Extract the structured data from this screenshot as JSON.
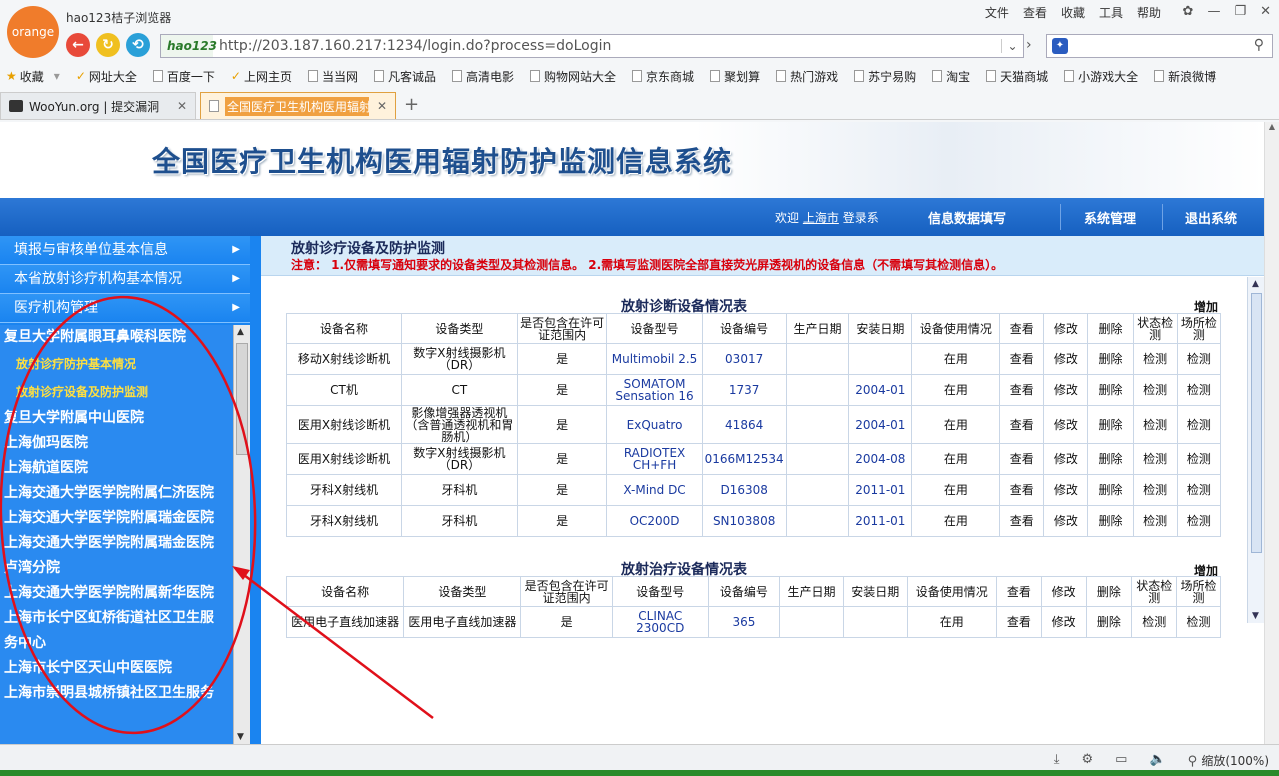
{
  "browser": {
    "logo_text": "orange",
    "app_title": "hao123桔子浏览器",
    "menu": [
      "文件",
      "查看",
      "收藏",
      "工具",
      "帮助"
    ],
    "url_brand": "hao123",
    "url": "http://203.187.160.217:1234/login.do?process=doLogin",
    "bookmarks": [
      "收藏",
      "网址大全",
      "百度一下",
      "上网主页",
      "当当网",
      "凡客诚品",
      "高清电影",
      "购物网站大全",
      "京东商城",
      "聚划算",
      "热门游戏",
      "苏宁易购",
      "淘宝",
      "天猫商城",
      "小游戏大全",
      "新浪微博"
    ],
    "tabs": [
      {
        "label": "WooYun.org | 提交漏洞"
      },
      {
        "label": "全国医疗卫生机构医用辐射防"
      }
    ],
    "zoom": "缩放(100%)"
  },
  "site": {
    "title": "全国医疗卫生机构医用辐射防护监测信息系统",
    "welcome_prefix": "欢迎",
    "welcome_city": "上海市",
    "welcome_suffix": "登录系",
    "nav": [
      "信息数据填写",
      "系统管理",
      "退出系统"
    ]
  },
  "sidebar": {
    "menus": [
      "填报与审核单位基本信息",
      "本省放射诊疗机构基本情况",
      "医疗机构管理"
    ],
    "tree": [
      {
        "label": "复旦大学附属眼耳鼻喉科医院",
        "type": "item"
      },
      {
        "label": "放射诊疗防护基本情况",
        "type": "sub"
      },
      {
        "label": "放射诊疗设备及防护监测",
        "type": "sub"
      },
      {
        "label": "复旦大学附属中山医院",
        "type": "item"
      },
      {
        "label": "上海伽玛医院",
        "type": "item"
      },
      {
        "label": "上海航道医院",
        "type": "item"
      },
      {
        "label": "上海交通大学医学院附属仁济医院",
        "type": "item"
      },
      {
        "label": "上海交通大学医学院附属瑞金医院",
        "type": "item"
      },
      {
        "label": "上海交通大学医学院附属瑞金医院",
        "type": "item"
      },
      {
        "label": "卢湾分院",
        "type": "item"
      },
      {
        "label": "上海交通大学医学院附属新华医院",
        "type": "item"
      },
      {
        "label": "上海市长宁区虹桥街道社区卫生服",
        "type": "item"
      },
      {
        "label": "务中心",
        "type": "item"
      },
      {
        "label": "上海市长宁区天山中医医院",
        "type": "item"
      },
      {
        "label": "上海市崇明县城桥镇社区卫生服务",
        "type": "item"
      }
    ]
  },
  "main": {
    "heading": "放射诊疗设备及防护监测",
    "notice": "注意： 1.仅需填写通知要求的设备类型及其检测信息。 2.需填写监测医院全部直接荧光屏透视机的设备信息（不需填写其检测信息）。",
    "diag": {
      "title": "放射诊断设备情况表",
      "add": "增加",
      "headers": [
        "设备名称",
        "设备类型",
        "是否包含在许可证范围内",
        "设备型号",
        "设备编号",
        "生产日期",
        "安装日期",
        "设备使用情况",
        "查看",
        "修改",
        "删除",
        "状态检测",
        "场所检测"
      ],
      "rows": [
        [
          "移动X射线诊断机",
          "数字X射线摄影机（DR）",
          "是",
          "Multimobil 2.5",
          "03017",
          "",
          "",
          "在用",
          "查看",
          "修改",
          "删除",
          "检测",
          "检测"
        ],
        [
          "CT机",
          "CT",
          "是",
          "SOMATOM Sensation 16",
          "1737",
          "",
          "2004-01",
          "在用",
          "查看",
          "修改",
          "删除",
          "检测",
          "检测"
        ],
        [
          "医用X射线诊断机",
          "影像增强器透视机（含普通透视机和胃肠机）",
          "是",
          "ExQuatro",
          "41864",
          "",
          "2004-01",
          "在用",
          "查看",
          "修改",
          "删除",
          "检测",
          "检测"
        ],
        [
          "医用X射线诊断机",
          "数字X射线摄影机（DR）",
          "是",
          "RADIOTEX CH+FH",
          "0166M12534",
          "",
          "2004-08",
          "在用",
          "查看",
          "修改",
          "删除",
          "检测",
          "检测"
        ],
        [
          "牙科X射线机",
          "牙科机",
          "是",
          "X-Mind DC",
          "D16308",
          "",
          "2011-01",
          "在用",
          "查看",
          "修改",
          "删除",
          "检测",
          "检测"
        ],
        [
          "牙科X射线机",
          "牙科机",
          "是",
          "OC200D",
          "SN103808",
          "",
          "2011-01",
          "在用",
          "查看",
          "修改",
          "删除",
          "检测",
          "检测"
        ]
      ]
    },
    "treat": {
      "title": "放射治疗设备情况表",
      "add": "增加",
      "headers": [
        "设备名称",
        "设备类型",
        "是否包含在许可证范围内",
        "设备型号",
        "设备编号",
        "生产日期",
        "安装日期",
        "设备使用情况",
        "查看",
        "修改",
        "删除",
        "状态检测",
        "场所检测"
      ],
      "rows": [
        [
          "医用电子直线加速器",
          "医用电子直线加速器",
          "是",
          "CLINAC 2300CD",
          "365",
          "",
          "",
          "在用",
          "查看",
          "修改",
          "删除",
          "检测",
          "检测"
        ]
      ]
    }
  },
  "colors": {
    "nav_blue": "#1660c0",
    "sidebar_blue": "#1a84f0",
    "notice_red": "#d8000c",
    "annotation_red": "#e0101a"
  }
}
